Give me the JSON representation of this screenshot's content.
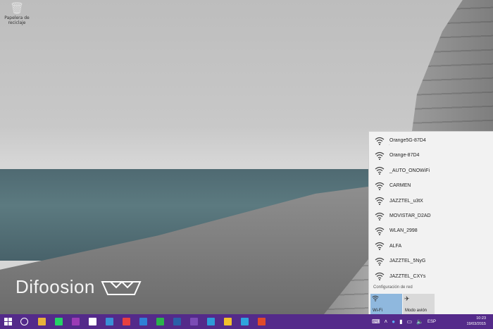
{
  "desktop": {
    "recycle_bin_label": "Papelera de reciclaje",
    "watermark_text": "Difoosion"
  },
  "flyout": {
    "networks": [
      {
        "name": "Orange5G-87D4",
        "sub": "·"
      },
      {
        "name": "Orange-87D4",
        "sub": ""
      },
      {
        "name": "_AUTO_ONOWiFi",
        "sub": ""
      },
      {
        "name": "CARMEN",
        "sub": ""
      },
      {
        "name": "JAZZTEL_u3tX",
        "sub": ""
      },
      {
        "name": "MOVISTAR_D2AD",
        "sub": ""
      },
      {
        "name": "WLAN_2998",
        "sub": ""
      },
      {
        "name": "ALFA",
        "sub": ""
      },
      {
        "name": "JAZZTEL_5NyG",
        "sub": ""
      },
      {
        "name": "JAZZTEL_CXYs",
        "sub": ""
      }
    ],
    "settings_label": "Configuración de red",
    "wifi_tile_label": "Wi-Fi",
    "airplane_tile_label": "Modo avión",
    "wifi_tile_on": true
  },
  "taskbar": {
    "apps": [
      {
        "icon": "file-explorer-icon",
        "color": "#e8b23a"
      },
      {
        "icon": "whatsapp-icon",
        "color": "#25d366"
      },
      {
        "icon": "onenote-icon",
        "color": "#9b3bb5"
      },
      {
        "icon": "store-icon",
        "color": "#ffffff"
      },
      {
        "icon": "trello-icon",
        "color": "#3a8fd6"
      },
      {
        "icon": "pocket-icon",
        "color": "#e84040"
      },
      {
        "icon": "calendar-icon",
        "color": "#2f7fd6"
      },
      {
        "icon": "feedly-icon",
        "color": "#2bb24c"
      },
      {
        "icon": "photoshop-icon",
        "color": "#2b5ea8"
      },
      {
        "icon": "pixelmator-icon",
        "color": "#7a4bb5"
      },
      {
        "icon": "visual-studio-icon",
        "color": "#2e9ad8"
      },
      {
        "icon": "chrome-icon",
        "color": "#f2c02c"
      },
      {
        "icon": "telegram-icon",
        "color": "#2fa3dd"
      },
      {
        "icon": "office-icon",
        "color": "#e04a2a"
      }
    ],
    "language": "ESP",
    "time": "10:23",
    "date": "19/03/2015"
  },
  "colors": {
    "taskbar": "#542a8a",
    "flyout_bg": "#f2f2f2",
    "wifi_tile": "#8fb8de"
  }
}
